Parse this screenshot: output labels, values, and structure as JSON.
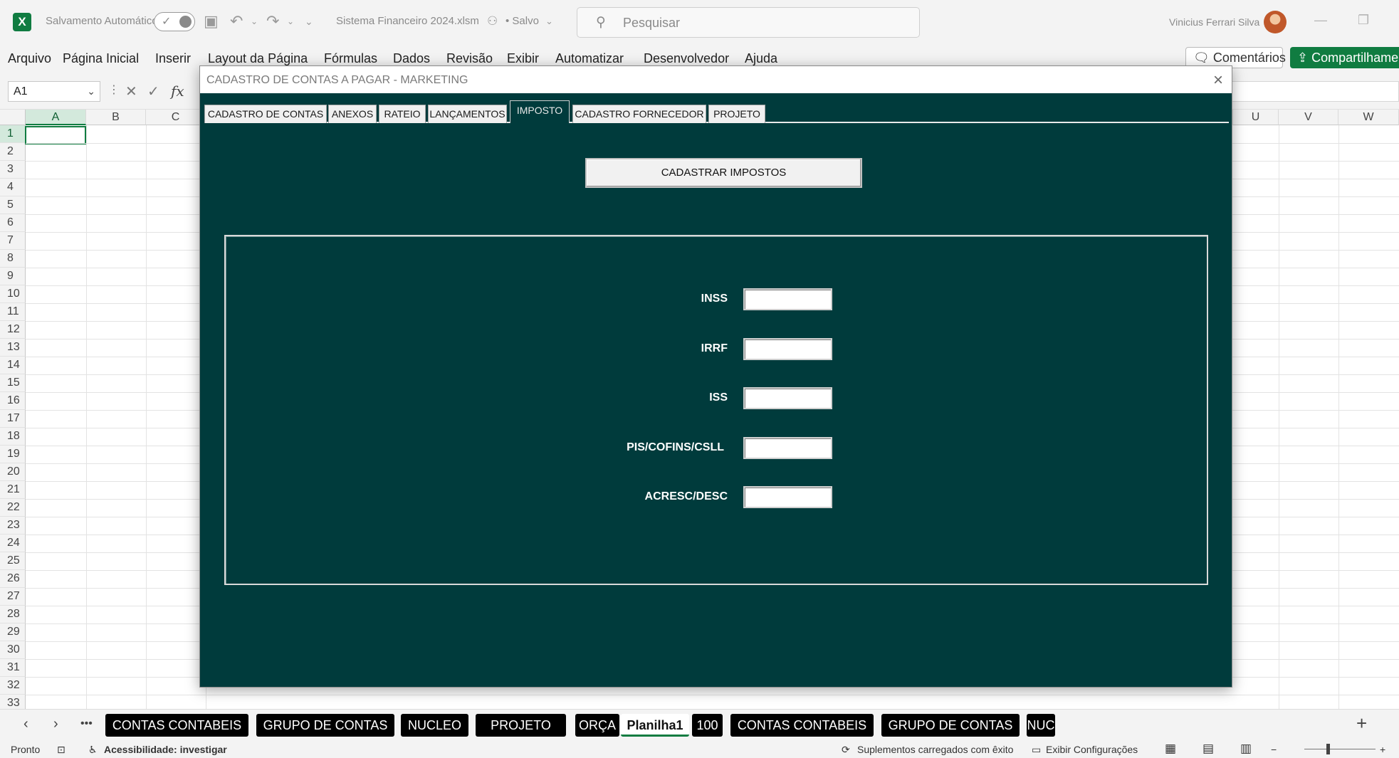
{
  "app": {
    "autosave_label": "Salvamento Automático",
    "filename": "Sistema Financeiro 2024.xlsm",
    "saved_status": "• Salvo",
    "search_placeholder": "Pesquisar",
    "user_name": "Vinicius Ferrari Silva",
    "brand_color": "#107c41"
  },
  "menu": {
    "items": [
      "Arquivo",
      "Página Inicial",
      "Inserir",
      "Layout da Página",
      "Fórmulas",
      "Dados",
      "Revisão",
      "Exibir",
      "Automatizar",
      "Desenvolvedor",
      "Ajuda"
    ],
    "comments_label": "Comentários",
    "share_label": "Compartilhamento"
  },
  "formula_bar": {
    "name_box": "A1",
    "fx": "fx"
  },
  "grid": {
    "columns_left": [
      "A",
      "B",
      "C"
    ],
    "columns_right": [
      "U",
      "V",
      "W"
    ],
    "rows": [
      "1",
      "2",
      "3",
      "4",
      "5",
      "6",
      "7",
      "8",
      "9",
      "10",
      "11",
      "12",
      "13",
      "14",
      "15",
      "16",
      "17",
      "18",
      "19",
      "20",
      "21",
      "22",
      "23",
      "24",
      "25",
      "26",
      "27",
      "28",
      "29",
      "30",
      "31",
      "32",
      "33"
    ],
    "selected_cell": "A1"
  },
  "dialog": {
    "title": "CADASTRO DE CONTAS A PAGAR - MARKETING",
    "background_color": "#003b3c",
    "tabs": [
      "CADASTRO DE CONTAS",
      "ANEXOS",
      "RATEIO",
      "LANÇAMENTOS",
      "IMPOSTO",
      "CADASTRO FORNECEDOR",
      "PROJETO"
    ],
    "active_tab": "IMPOSTO",
    "register_button": "CADASTRAR IMPOSTOS",
    "fields": [
      {
        "label": "INSS",
        "value": ""
      },
      {
        "label": "IRRF",
        "value": ""
      },
      {
        "label": "ISS",
        "value": ""
      },
      {
        "label": "PIS/COFINS/CSLL",
        "value": ""
      },
      {
        "label": "ACRESC/DESC",
        "value": ""
      }
    ]
  },
  "sheets": {
    "tabs": [
      "CONTAS CONTABEIS",
      "GRUPO DE CONTAS",
      "NUCLEO",
      "PROJETO",
      "ORÇA",
      "Planilha1",
      "100",
      "CONTAS CONTABEIS",
      "GRUPO DE CONTAS",
      "NUC"
    ],
    "active": "Planilha1"
  },
  "status": {
    "ready": "Pronto",
    "accessibility": "Acessibilidade: investigar",
    "addins": "Suplementos carregados com êxito",
    "display_settings": "Exibir Configurações"
  }
}
